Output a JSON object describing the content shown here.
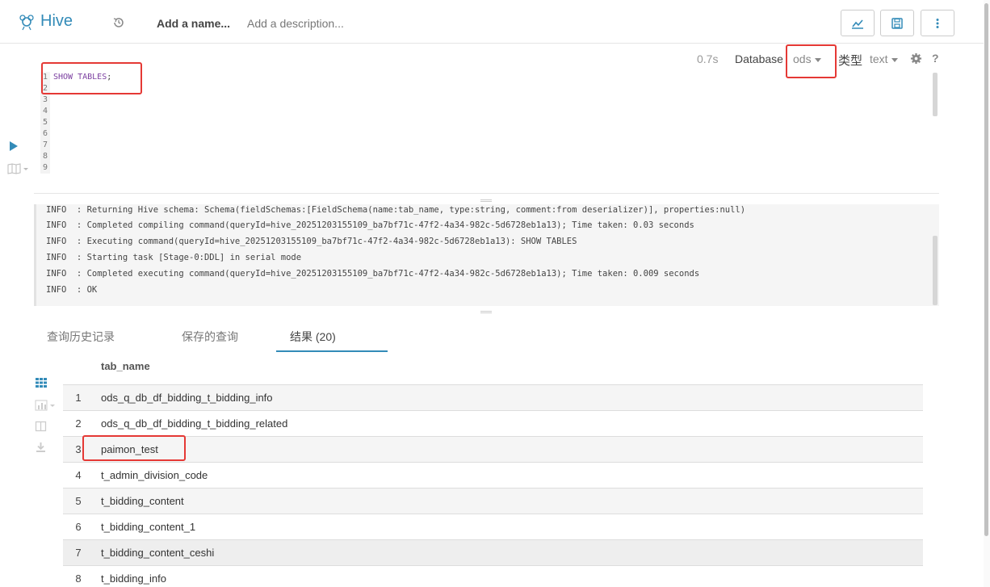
{
  "header": {
    "app_name": "Hive",
    "name_placeholder": "Add a name...",
    "description_placeholder": "Add a description..."
  },
  "editor_toolbar": {
    "exec_time": "0.7s",
    "database_label": "Database",
    "database_value": "ods",
    "type_label": "类型",
    "type_value": "text",
    "help": "?"
  },
  "editor": {
    "line_numbers": [
      "1",
      "2",
      "3",
      "4",
      "5",
      "6",
      "7",
      "8",
      "9"
    ],
    "code_keyword": "SHOW TABLES",
    "code_semicolon": ";"
  },
  "log": {
    "lines": [
      "INFO  : Returning Hive schema: Schema(fieldSchemas:[FieldSchema(name:tab_name, type:string, comment:from deserializer)], properties:null)",
      "INFO  : Completed compiling command(queryId=hive_20251203155109_ba7bf71c-47f2-4a34-982c-5d6728eb1a13); Time taken: 0.03 seconds",
      "INFO  : Executing command(queryId=hive_20251203155109_ba7bf71c-47f2-4a34-982c-5d6728eb1a13): SHOW TABLES",
      "INFO  : Starting task [Stage-0:DDL] in serial mode",
      "INFO  : Completed executing command(queryId=hive_20251203155109_ba7bf71c-47f2-4a34-982c-5d6728eb1a13); Time taken: 0.009 seconds",
      "INFO  : OK"
    ]
  },
  "tabs": {
    "history": "查询历史记录",
    "saved": "保存的查询",
    "results": "结果 (20)"
  },
  "results": {
    "column": "tab_name",
    "rows": [
      {
        "n": "1",
        "name": "ods_q_db_df_bidding_t_bidding_info"
      },
      {
        "n": "2",
        "name": "ods_q_db_df_bidding_t_bidding_related"
      },
      {
        "n": "3",
        "name": "paimon_test"
      },
      {
        "n": "4",
        "name": "t_admin_division_code"
      },
      {
        "n": "5",
        "name": "t_bidding_content"
      },
      {
        "n": "6",
        "name": "t_bidding_content_1"
      },
      {
        "n": "7",
        "name": "t_bidding_content_ceshi"
      },
      {
        "n": "8",
        "name": "t_bidding_info"
      }
    ]
  },
  "colors": {
    "accent": "#338bb8",
    "highlight_border": "#e53935"
  }
}
